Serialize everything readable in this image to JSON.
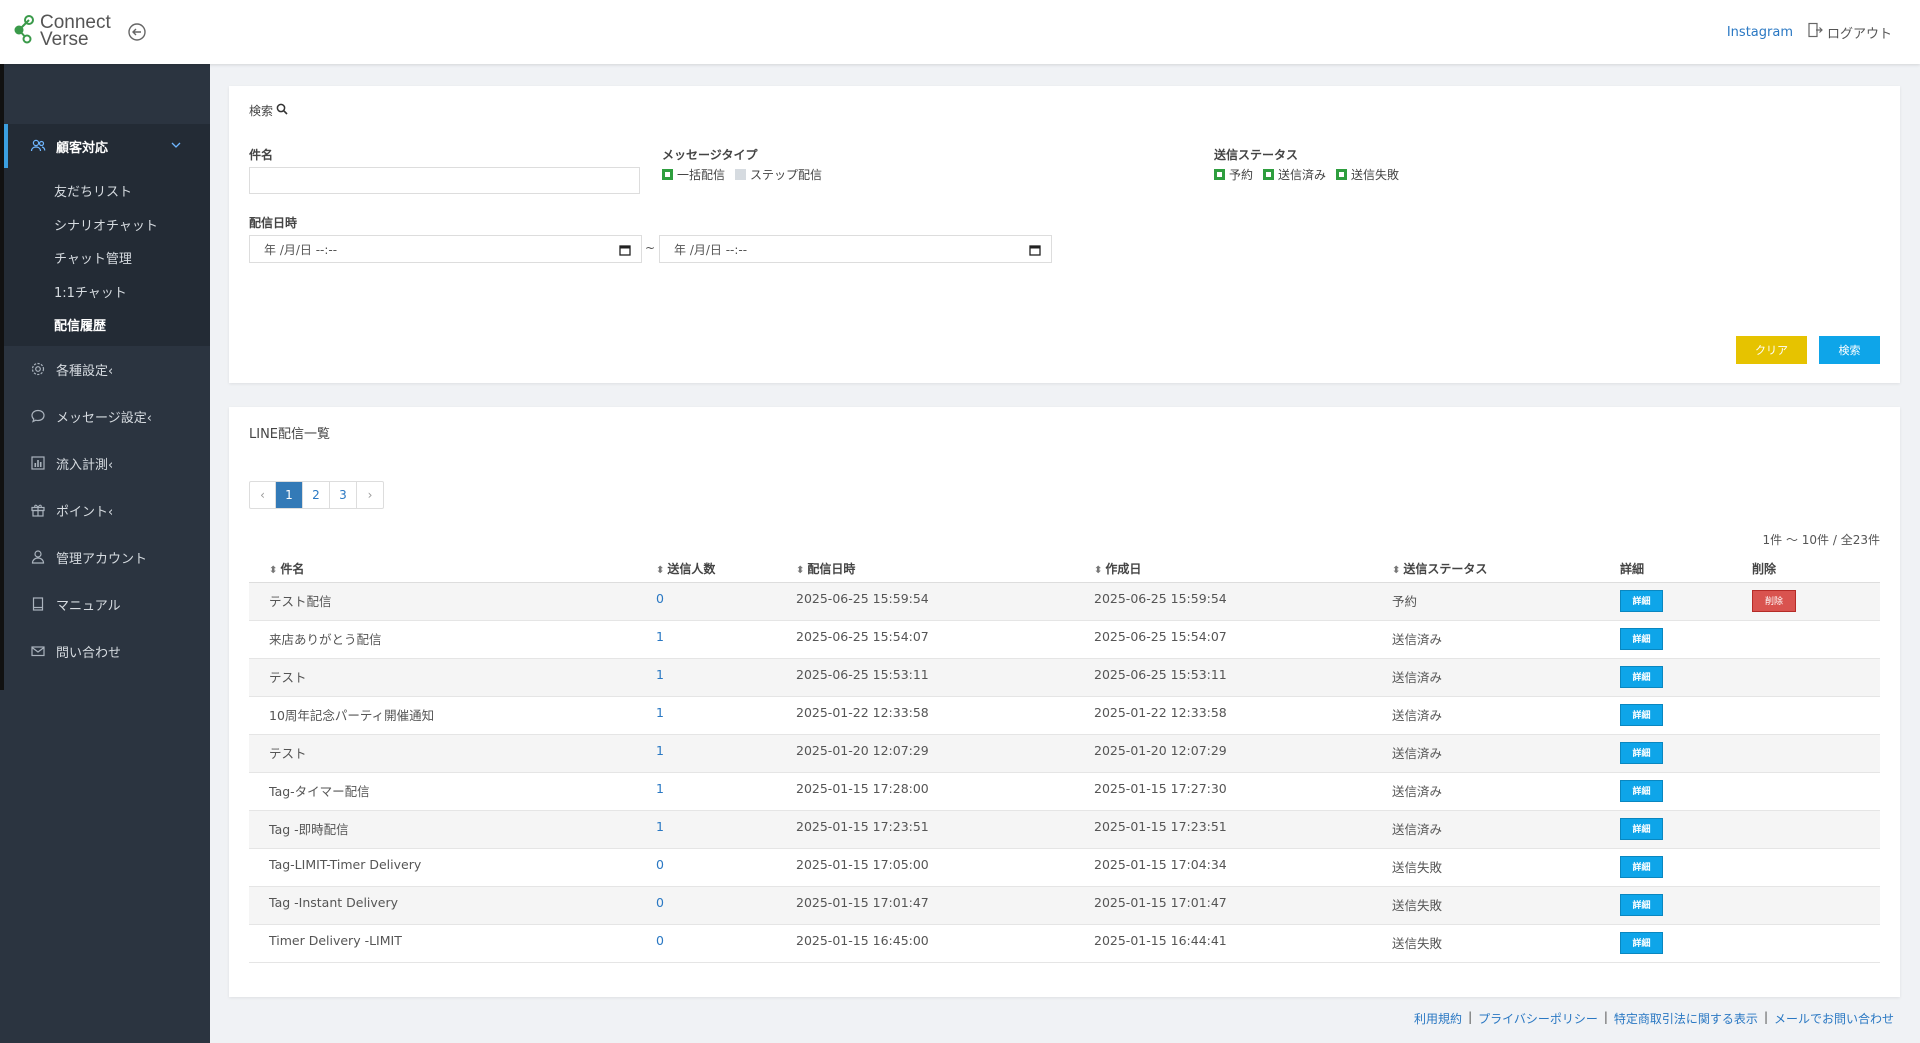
{
  "header": {
    "logo_line1": "Connect",
    "logo_line2": "Verse",
    "instagram": "Instagram",
    "logout": "ログアウト"
  },
  "sidebar": {
    "active_group": "顧客対応",
    "sub_items": [
      "友だちリスト",
      "シナリオチャット",
      "チャット管理",
      "1:1チャット",
      "配信履歴"
    ],
    "items": [
      {
        "label": "各種設定‹",
        "icon": "gear-icon"
      },
      {
        "label": "メッセージ設定‹",
        "icon": "chat-bubble-icon"
      },
      {
        "label": "流入計測‹",
        "icon": "bar-chart-icon"
      },
      {
        "label": "ポイント‹",
        "icon": "gift-icon"
      },
      {
        "label": "管理アカウント",
        "icon": "user-icon"
      },
      {
        "label": "マニュアル",
        "icon": "book-icon"
      },
      {
        "label": "問い合わせ",
        "icon": "mail-icon"
      }
    ]
  },
  "search": {
    "title": "検索",
    "subject_label": "件名",
    "subject_value": "",
    "msgtype_label": "メッセージタイプ",
    "msgtype_options": [
      {
        "label": "一括配信",
        "checked": true
      },
      {
        "label": "ステップ配信",
        "checked": false
      }
    ],
    "status_label": "送信ステータス",
    "status_options": [
      {
        "label": "予約",
        "checked": true
      },
      {
        "label": "送信済み",
        "checked": true
      },
      {
        "label": "送信失敗",
        "checked": true
      }
    ],
    "date_label": "配信日時",
    "date_from": "年 /月/日 --:--",
    "date_to": "年 /月/日 --:--",
    "tilde": "~",
    "clear_btn": "クリア",
    "search_btn": "検索"
  },
  "list": {
    "title": "LINE配信一覧",
    "pager": [
      "‹",
      "1",
      "2",
      "3",
      "›"
    ],
    "current_page": "1",
    "count_text": "1件 〜 10件 / 全23件",
    "headers": [
      "件名",
      "送信人数",
      "配信日時",
      "作成日",
      "送信ステータス",
      "詳細",
      "削除"
    ],
    "detail_btn": "詳細",
    "delete_btn": "削除",
    "rows": [
      {
        "subject": "テスト配信",
        "recipients": "0",
        "delivered": "2025-06-25 15:59:54",
        "created": "2025-06-25 15:59:54",
        "status": "予約",
        "deletable": true
      },
      {
        "subject": "来店ありがとう配信",
        "recipients": "1",
        "delivered": "2025-06-25 15:54:07",
        "created": "2025-06-25 15:54:07",
        "status": "送信済み",
        "deletable": false
      },
      {
        "subject": "テスト",
        "recipients": "1",
        "delivered": "2025-06-25 15:53:11",
        "created": "2025-06-25 15:53:11",
        "status": "送信済み",
        "deletable": false
      },
      {
        "subject": "10周年記念パーティ開催通知",
        "recipients": "1",
        "delivered": "2025-01-22 12:33:58",
        "created": "2025-01-22 12:33:58",
        "status": "送信済み",
        "deletable": false
      },
      {
        "subject": "テスト",
        "recipients": "1",
        "delivered": "2025-01-20 12:07:29",
        "created": "2025-01-20 12:07:29",
        "status": "送信済み",
        "deletable": false
      },
      {
        "subject": "Tag-タイマー配信",
        "recipients": "1",
        "delivered": "2025-01-15 17:28:00",
        "created": "2025-01-15 17:27:30",
        "status": "送信済み",
        "deletable": false
      },
      {
        "subject": "Tag -即時配信",
        "recipients": "1",
        "delivered": "2025-01-15 17:23:51",
        "created": "2025-01-15 17:23:51",
        "status": "送信済み",
        "deletable": false
      },
      {
        "subject": "Tag-LIMIT-Timer Delivery",
        "recipients": "0",
        "delivered": "2025-01-15 17:05:00",
        "created": "2025-01-15 17:04:34",
        "status": "送信失敗",
        "deletable": false
      },
      {
        "subject": "Tag -Instant Delivery",
        "recipients": "0",
        "delivered": "2025-01-15 17:01:47",
        "created": "2025-01-15 17:01:47",
        "status": "送信失敗",
        "deletable": false
      },
      {
        "subject": "Timer Delivery -LIMIT",
        "recipients": "0",
        "delivered": "2025-01-15 16:45:00",
        "created": "2025-01-15 16:44:41",
        "status": "送信失敗",
        "deletable": false
      }
    ]
  },
  "footer": {
    "links": [
      "利用規約",
      "プライバシーポリシー",
      "特定商取引法に関する表示",
      "メールでお問い合わせ"
    ],
    "separator": "|"
  },
  "colors": {
    "sidebar_bg": "#2b3440",
    "accent_blue": "#0ea5e9",
    "clear_yellow": "#e6c300",
    "delete_red": "#d9534f",
    "check_green": "#2e9e3e"
  }
}
